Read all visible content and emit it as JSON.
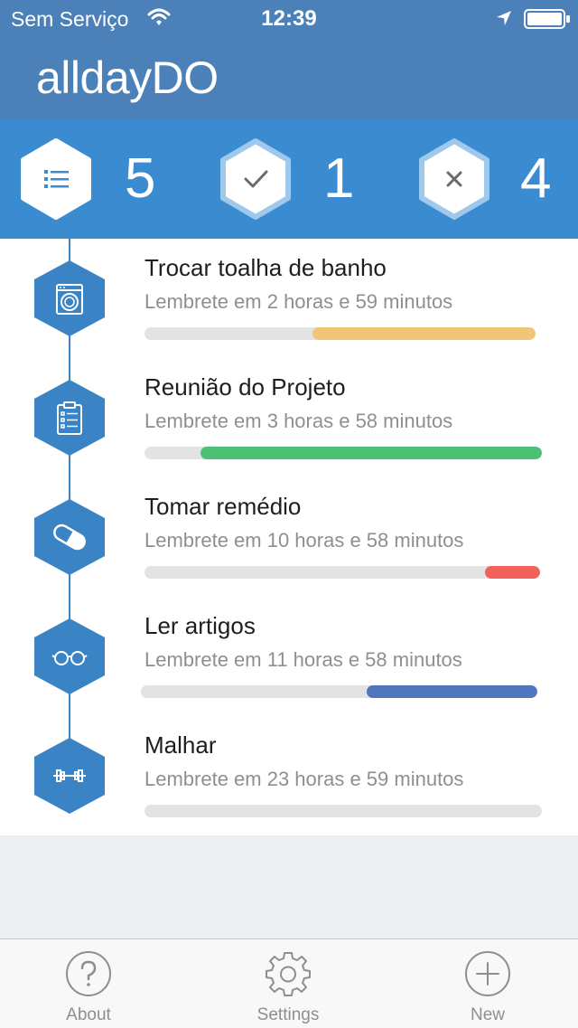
{
  "status_bar": {
    "carrier": "Sem Serviço",
    "time": "12:39"
  },
  "app": {
    "title": "alldayDO"
  },
  "summary": {
    "pending": {
      "icon": "list-icon",
      "count": "5"
    },
    "done": {
      "icon": "check-icon",
      "count": "1"
    },
    "missed": {
      "icon": "x-icon",
      "count": "4"
    }
  },
  "tasks": [
    {
      "icon": "washing-machine-icon",
      "title": "Trocar toalha de banho",
      "reminder": "Lembrete em 2 horas e 59 minutos",
      "progress": 0.57,
      "color": "#f2c478"
    },
    {
      "icon": "clipboard-icon",
      "title": "Reunião do Projeto",
      "reminder": "Lembrete em 3 horas e 58 minutos",
      "progress": 0.86,
      "color": "#4cc175"
    },
    {
      "icon": "pill-icon",
      "title": "Tomar remédio",
      "reminder": "Lembrete em 10 horas e 58 minutos",
      "progress": 0.14,
      "color": "#f0625a"
    },
    {
      "icon": "glasses-icon",
      "title": "Ler artigos",
      "reminder": "Lembrete em 11 horas e 58 minutos",
      "progress": 0.43,
      "color": "#5076bf"
    },
    {
      "icon": "dumbbell-icon",
      "title": "Malhar",
      "reminder": "Lembrete em 23 horas e 59 minutos",
      "progress": 0.0,
      "color": "#e3e3e3"
    }
  ],
  "tabbar": {
    "about": {
      "icon": "question-icon",
      "label": "About"
    },
    "settings": {
      "icon": "gear-icon",
      "label": "Settings"
    },
    "new": {
      "icon": "plus-circle-icon",
      "label": "New"
    }
  },
  "colors": {
    "header": "#4b80b8",
    "summary": "#3b8bd0",
    "accent": "#3a84c6"
  }
}
